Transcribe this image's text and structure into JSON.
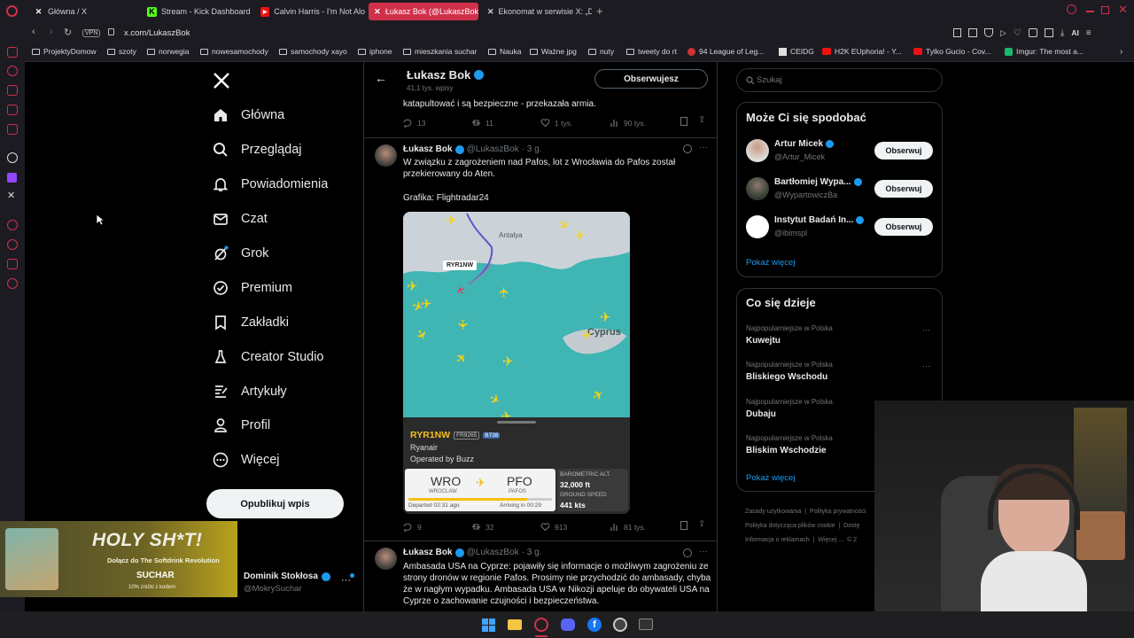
{
  "browser": {
    "tabs": [
      {
        "label": "Główna / X",
        "icon": "x-logo-icon",
        "active": false
      },
      {
        "label": "Stream - Kick Dashboard",
        "icon": "kick-icon",
        "active": false
      },
      {
        "label": "Calvin Harris - I'm Not Alo",
        "icon": "youtube-icon",
        "active": false
      },
      {
        "label": "Łukasz Bok (@LukaszBok",
        "icon": "x-logo-icon",
        "active": true
      },
      {
        "label": "Ekonomat w serwisie X: „D",
        "icon": "x-logo-icon",
        "active": false
      }
    ],
    "url": "x.com/LukaszBok",
    "vpn": "VPN",
    "ai": "AI",
    "bookmarks": [
      "ProjektyDomow",
      "szoty",
      "norwegia",
      "nowesamochody",
      "samochody xayo",
      "iphone",
      "mieszkania suchar",
      "Nauka",
      "Ważne jpg",
      "nuty",
      "tweety do rt",
      "94 League of Leg...",
      "CEIDG",
      "H2K EUphoria! - Y...",
      "Tylko Gucio - Cov...",
      "Imgur: The most a..."
    ]
  },
  "nav": {
    "items": [
      "Główna",
      "Przeglądaj",
      "Powiadomienia",
      "Czat",
      "Grok",
      "Premium",
      "Zakładki",
      "Creator Studio",
      "Artykuły",
      "Profil",
      "Więcej"
    ],
    "post_button": "Opublikuj wpis",
    "account_name": "Dominik Stokłosa",
    "account_handle": "@MokrySuchar"
  },
  "ad": {
    "headline": "HOLY SH*T!",
    "line": "Dołącz do The Softdrink Revolution",
    "brand": "SUCHAR",
    "promo": "10% zniżki z kodem"
  },
  "profile_header": {
    "name": "Łukasz Bok",
    "posts": "41,1 tys. wpisy",
    "follow": "Obserwujesz"
  },
  "prev_tweet": {
    "text": "katapultować i są bezpieczne - przekazała armia.",
    "replies": "13",
    "reposts": "11",
    "likes": "1 tys.",
    "views": "90 tys."
  },
  "tweet1": {
    "name": "Łukasz Bok",
    "handle": "@LukaszBok",
    "time": "· 3 g.",
    "text": "W związku z zagrożeniem nad Pafos, lot z Wrocławia do Pafos został przekierowany do Aten.",
    "text2": "Grafika: Flightradar24",
    "replies": "9",
    "reposts": "32",
    "likes": "913",
    "views": "81 tys."
  },
  "flight": {
    "callsign": "RYR1NW",
    "map_label": "RYR1NW",
    "flight_no": "FR9265",
    "aircraft": "B738",
    "airline": "Ryanair",
    "operator": "Operated by Buzz",
    "from_code": "WRO",
    "from_city": "WROCLAW",
    "to_code": "PFO",
    "to_city": "PAFOS",
    "departed": "Departed 02:31 ago",
    "arriving": "Arriving in 00:29",
    "alt_label": "BAROMETRIC ALT.",
    "alt": "32,000 ft",
    "speed_label": "GROUND SPEED",
    "speed": "441 kts",
    "map_city1": "Antalya",
    "map_city2": "Cyprus",
    "route_progress": 0.83
  },
  "tweet2": {
    "name": "Łukasz Bok",
    "handle": "@LukaszBok",
    "time": "· 3 g.",
    "text": "Ambasada USA na Cyprze: pojawiły się informacje o możliwym zagrożeniu ze strony dronów w regionie Pafos. Prosimy nie przychodzić do ambasady, chyba że w nagłym wypadku. Ambasada USA w Nikozji apeluje do obywateli USA na Cyprze o zachowanie czujności i bezpieczeństwa."
  },
  "search": {
    "placeholder": "Szukaj"
  },
  "suggest": {
    "title": "Może Ci się spodobać",
    "users": [
      {
        "name": "Artur Micek",
        "handle": "@Artur_Micek",
        "btn": "Obserwuj"
      },
      {
        "name": "Bartłomiej Wypa...",
        "handle": "@WypartowiczBa",
        "btn": "Obserwuj"
      },
      {
        "name": "Instytut Badań In...",
        "handle": "@ibimspl",
        "btn": "Obserwuj"
      }
    ],
    "more": "Pokaż więcej"
  },
  "trends": {
    "title": "Co się dzieje",
    "items": [
      {
        "meta": "Najpopularniejsze w Polska",
        "name": "Kuwejtu"
      },
      {
        "meta": "Najpopularniejsze w Polska",
        "name": "Bliskiego Wschodu"
      },
      {
        "meta": "Najpopularniejsze w Polska",
        "name": "Dubaju"
      },
      {
        "meta": "Najpopularniejsze w Polska",
        "name": "Bliskim Wschodzie"
      }
    ],
    "more": "Pokaż więcej"
  },
  "footer": [
    "Zasady użytkowania",
    "Polityka prywatności",
    "Polityka dotycząca plików cookie",
    "Dostę",
    "Informacja o reklamach",
    "Więcej ...",
    "© 2"
  ],
  "colors": {
    "accent": "#1d9bf0",
    "tab_active": "#d0304a",
    "plane": "#f4d21b",
    "sea": "#3fb5b4",
    "callsign": "#f4c018"
  }
}
